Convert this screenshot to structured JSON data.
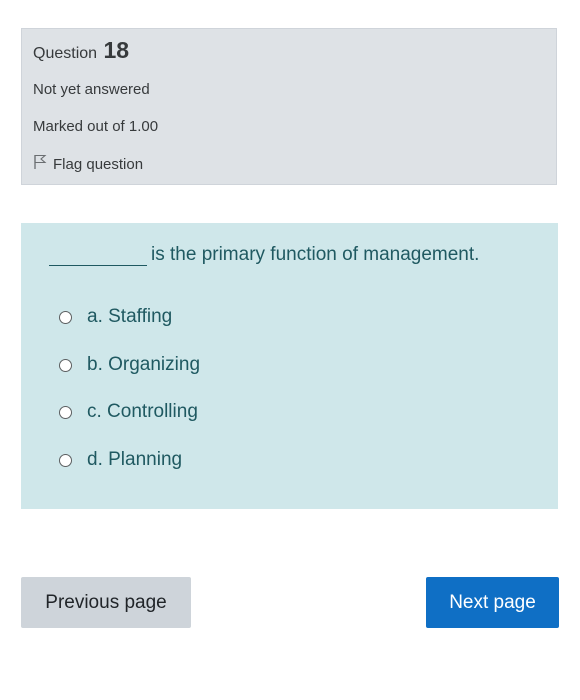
{
  "info": {
    "question_label": "Question",
    "question_number": "18",
    "state": "Not yet answered",
    "grade": "Marked out of 1.00",
    "flag_label": "Flag question"
  },
  "question": {
    "blank": "________",
    "text": "is the primary function of management.",
    "options": [
      {
        "label": "a. Staffing"
      },
      {
        "label": "b. Organizing"
      },
      {
        "label": "c. Controlling"
      },
      {
        "label": "d. Planning"
      }
    ]
  },
  "nav": {
    "previous_label": "Previous page",
    "next_label": "Next page"
  },
  "colors": {
    "info_bg": "#dee2e6",
    "content_bg": "#cfe7ea",
    "primary": "#0f6fc5",
    "secondary": "#ced4da"
  }
}
